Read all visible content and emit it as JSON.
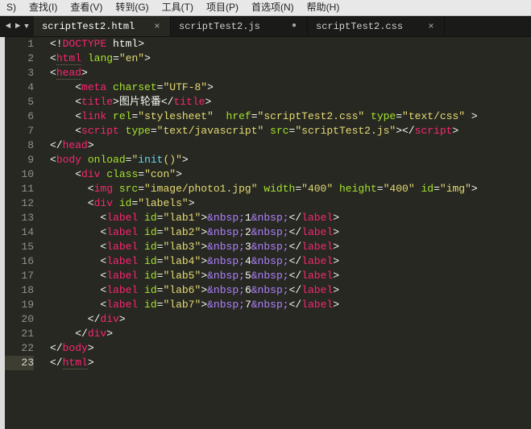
{
  "menu": {
    "items": [
      "S)",
      "查找(I)",
      "查看(V)",
      "转到(G)",
      "工具(T)",
      "项目(P)",
      "首选项(N)",
      "帮助(H)"
    ]
  },
  "nav": {
    "left": "◄",
    "right": "►",
    "dropdown": "▼"
  },
  "tabs": [
    {
      "label": "scriptTest2.html",
      "active": true,
      "dirty": false,
      "close": "×"
    },
    {
      "label": "scriptTest2.js",
      "active": false,
      "dirty": true,
      "dot": "●"
    },
    {
      "label": "scriptTest2.css",
      "active": false,
      "dirty": false,
      "close": "×"
    }
  ],
  "line_numbers": [
    "1",
    "2",
    "3",
    "4",
    "5",
    "6",
    "7",
    "8",
    "9",
    "10",
    "11",
    "12",
    "13",
    "14",
    "15",
    "16",
    "17",
    "18",
    "19",
    "20",
    "21",
    "22",
    "23"
  ],
  "active_line": 23,
  "source": {
    "doctype": "html",
    "html_lang": "en",
    "head": {
      "meta_charset": "UTF-8",
      "title_text": "图片轮番",
      "link": {
        "rel": "stylesheet",
        "href": "scriptTest2.css",
        "type": "text/css"
      },
      "script": {
        "type": "text/javascript",
        "src": "scriptTest2.js"
      }
    },
    "body": {
      "onload": "init()",
      "div": {
        "class": "con",
        "img": {
          "src": "image/photo1.jpg",
          "width": "400",
          "height": "400",
          "id": "img"
        },
        "labels_id": "labels",
        "labels": [
          {
            "id": "lab1",
            "text": "1"
          },
          {
            "id": "lab2",
            "text": "2"
          },
          {
            "id": "lab3",
            "text": "3"
          },
          {
            "id": "lab4",
            "text": "4"
          },
          {
            "id": "lab5",
            "text": "5"
          },
          {
            "id": "lab6",
            "text": "6"
          },
          {
            "id": "lab7",
            "text": "7"
          }
        ]
      }
    }
  },
  "tokens": {
    "html": "html",
    "head": "head",
    "body": "body",
    "meta": "meta",
    "title": "title",
    "link": "link",
    "script": "script",
    "div": "div",
    "img": "img",
    "label": "label",
    "DOCTYPE": "DOCTYPE",
    "attrs": {
      "lang": "lang",
      "charset": "charset",
      "rel": "rel",
      "href": "href",
      "type": "type",
      "src": "src",
      "onload": "onload",
      "class": "class",
      "width": "width",
      "height": "height",
      "id": "id"
    },
    "entity": "&nbsp;",
    "fn": "init"
  }
}
